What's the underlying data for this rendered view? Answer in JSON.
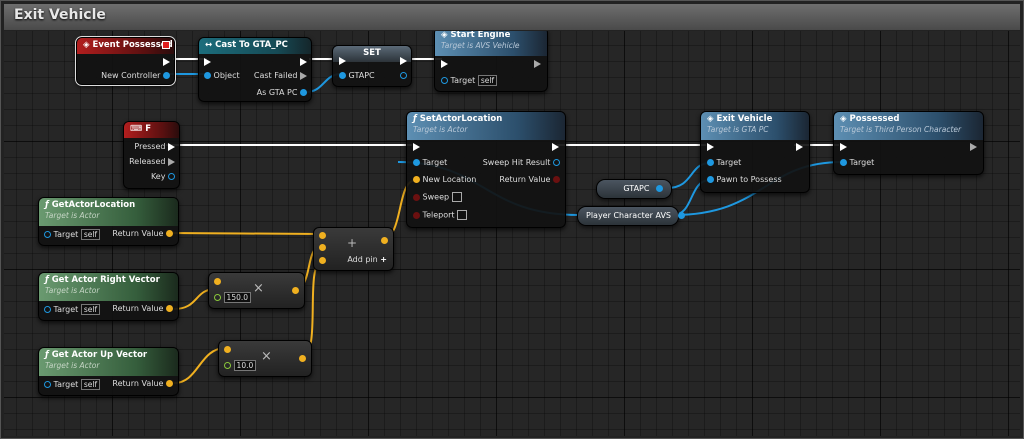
{
  "graph_title": "Exit Vehicle",
  "nodes": {
    "event_possessed": {
      "title": "Event Possessed",
      "pin_new_controller": "New Controller"
    },
    "cast_to_gta_pc": {
      "title": "Cast To GTA_PC",
      "pin_object": "Object",
      "pin_cast_failed": "Cast Failed",
      "pin_as_gta_pc": "As GTA PC"
    },
    "set_node": {
      "title": "SET",
      "pin_gtapc": "GTAPC"
    },
    "start_engine": {
      "title": "Start Engine",
      "subtitle": "Target is AVS Vehicle",
      "pin_target": "Target",
      "target_value": "self"
    },
    "key_f": {
      "title": "F",
      "pin_pressed": "Pressed",
      "pin_released": "Released",
      "pin_key": "Key"
    },
    "set_actor_location": {
      "title": "SetActorLocation",
      "subtitle": "Target is Actor",
      "pin_target": "Target",
      "pin_new_location": "New Location",
      "pin_sweep": "Sweep",
      "pin_teleport": "Teleport",
      "pin_sweep_hit": "Sweep Hit Result",
      "pin_return": "Return Value"
    },
    "exit_vehicle": {
      "title": "Exit Vehicle",
      "subtitle": "Target is GTA PC",
      "pin_target": "Target",
      "pin_pawn": "Pawn to Possess"
    },
    "possessed": {
      "title": "Possessed",
      "subtitle": "Target is Third Person Character",
      "pin_target": "Target"
    },
    "get_actor_location": {
      "title": "GetActorLocation",
      "subtitle": "Target is Actor",
      "pin_target": "Target",
      "target_value": "self",
      "pin_return": "Return Value"
    },
    "get_actor_right": {
      "title": "Get Actor Right Vector",
      "subtitle": "Target is Actor",
      "pin_target": "Target",
      "target_value": "self",
      "pin_return": "Return Value"
    },
    "get_actor_up": {
      "title": "Get Actor Up Vector",
      "subtitle": "Target is Actor",
      "pin_target": "Target",
      "target_value": "self",
      "pin_return": "Return Value"
    },
    "multiply_right": {
      "value": "150.0",
      "op": "×"
    },
    "multiply_up": {
      "value": "10.0",
      "op": "×"
    },
    "add_node": {
      "op": "+",
      "add_pin_label": "Add pin",
      "add_pin_icon": "+"
    }
  },
  "variables": {
    "gtapc": "GTAPC",
    "player_character": "Player Character AVS"
  },
  "icons": {
    "event": "event-diamond-icon",
    "function": "function-f-icon",
    "cast": "cast-arrows-icon",
    "keyboard": "keyboard-icon"
  },
  "colors": {
    "event_header": "#b21e1e",
    "function_header": "#5d8fb3",
    "pure_header": "#6a9a70",
    "cast_header": "#1c6d7c",
    "object_pin": "#1e98e0",
    "vector_pin": "#f0b020",
    "float_pin": "#8ac83a",
    "exec_pin": "#ffffff"
  }
}
